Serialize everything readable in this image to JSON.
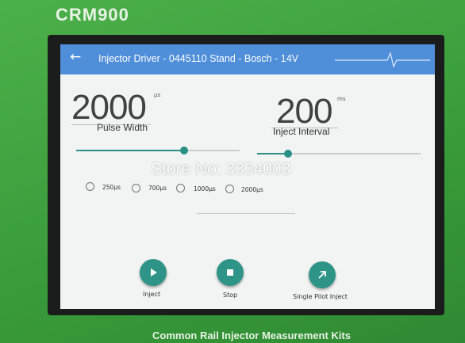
{
  "device": {
    "brand": "CRM900",
    "footer": "Common Rail Injector Measurement Kits",
    "watermark": "Store No: 3334003"
  },
  "header": {
    "back_icon": "arrow-left-icon",
    "title": "Injector Driver - 0445110 Stand - Bosch - 14V",
    "wave_icon": "pulse-wave-icon"
  },
  "pulse_width": {
    "value": "2000",
    "unit": "μs",
    "label": "Pulse Width",
    "slider_fraction": 0.66
  },
  "inject_interval": {
    "value": "200",
    "unit": "ms",
    "label": "Inject Interval",
    "slider_fraction": 0.19
  },
  "presets": [
    {
      "label": "250μs",
      "selected": false
    },
    {
      "label": "700μs",
      "selected": false
    },
    {
      "label": "1000μs",
      "selected": false
    },
    {
      "label": "2000μs",
      "selected": false
    }
  ],
  "actions": {
    "inject": {
      "label": "Inject",
      "icon": "play-icon"
    },
    "stop": {
      "label": "Stop",
      "icon": "stop-icon"
    },
    "single_pilot": {
      "label": "Single Pilot Inject",
      "icon": "arrow-up-right-icon"
    }
  },
  "colors": {
    "appbar": "#4f8ed9",
    "accent": "#2a8f85",
    "case": "#3a9e3c"
  }
}
